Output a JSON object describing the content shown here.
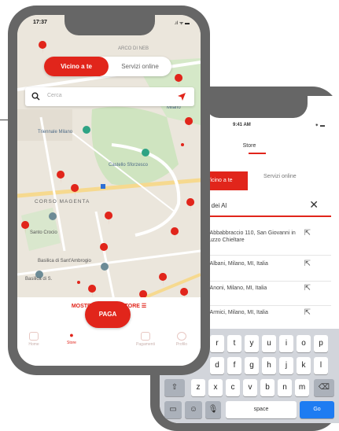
{
  "colors": {
    "accent": "#e1251b",
    "frame": "#666666",
    "map_bg": "#ebe6dc",
    "keyboard_bg": "#d2d5db",
    "go_key": "#1e7cf2"
  },
  "phone_front": {
    "status_time": "17:37",
    "status_icons": ".ıl ᯤ ▬",
    "map_top_label": "ARCO DI NEB",
    "toggle_near": "Vicino a te",
    "toggle_online": "Servizi online",
    "search_placeholder": "Cerca",
    "map_labels": [
      "Triennale Milano",
      "Castello Sforzesco",
      "Giardini Pubblici di Milano",
      "CORSO MAGENTA",
      "Santo Crocio",
      "Basilica di Sant'Ambrogio",
      "Basilica di S."
    ],
    "list_link": "MOSTRA ELENCO STORE",
    "pay_button": "PAGA",
    "nav": [
      "Home",
      "Store",
      "Pagamenti",
      "Profilo"
    ]
  },
  "phone_back": {
    "status_time": "9:41 AM",
    "status_right": "⁕ ▬",
    "title": "Store",
    "tab_active": "Vicino a te",
    "tab_inactive": "Servizi online",
    "search_value": "Via dei Al",
    "clear_icon": "close-icon",
    "results": [
      "Via Abbabbraccio 110, San Giovanni in Abruzzo Chieltare",
      "Via Albani, Milano, MI, Italia",
      "Via Anoni, Milano, MI, Italia",
      "Via Armici, Milano, MI, Italia"
    ],
    "keyboard": {
      "row1": [
        "r",
        "t",
        "y",
        "u",
        "i",
        "o",
        "p"
      ],
      "row2": [
        "d",
        "f",
        "g",
        "h",
        "j",
        "k",
        "l"
      ],
      "row3": [
        "z",
        "x",
        "c",
        "v",
        "b",
        "n",
        "m"
      ],
      "space": "space",
      "go": "Go"
    }
  }
}
